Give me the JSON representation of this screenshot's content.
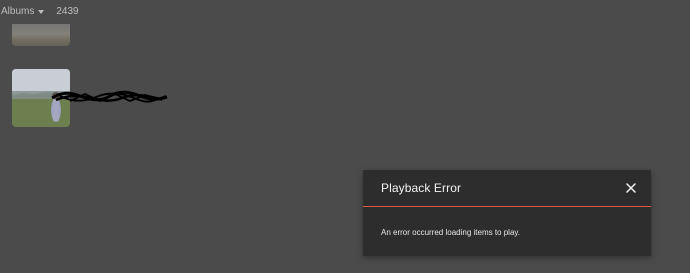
{
  "topbar": {
    "albums_label": "Albums",
    "count": "2439"
  },
  "dialog": {
    "title": "Playback Error",
    "message": "An error occurred loading items to play.",
    "close_icon": "close-icon",
    "accent_color": "#e05a44"
  },
  "icons": {
    "dropdown": "chevron-down-icon"
  }
}
